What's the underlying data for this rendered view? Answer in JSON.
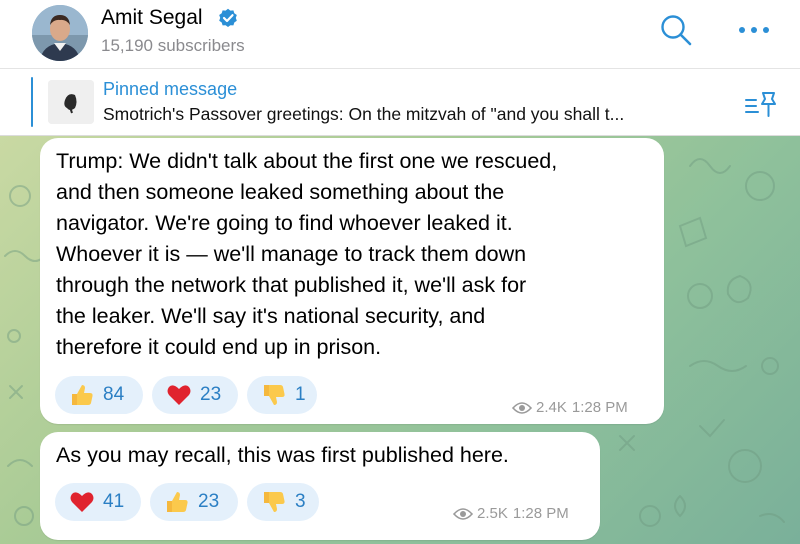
{
  "header": {
    "channel_name": "Amit Segal",
    "subscribers": "15,190 subscribers",
    "icons": {
      "verified": "verified-badge-icon",
      "search": "search-icon",
      "more": "more-dots-icon"
    }
  },
  "pinned": {
    "title": "Pinned message",
    "text": "Smotrich's Passover greetings:  On the mitzvah of \"and you shall t...",
    "icon": "unpin-icon"
  },
  "messages": [
    {
      "lines": [
        "Trump: We didn't talk about the first one we rescued,",
        "and then someone leaked something about the",
        "navigator. We're going to find whoever leaked it.",
        "Whoever it is — we'll manage to track them down",
        "through the network that published it, we'll ask for",
        "the leaker. We'll say it's national security, and",
        "therefore it could end up in prison."
      ],
      "reactions": [
        {
          "emoji": "thumbs-up",
          "count": "84"
        },
        {
          "emoji": "red-heart",
          "count": "23"
        },
        {
          "emoji": "thumbs-down",
          "count": "1"
        }
      ],
      "views": "2.4K",
      "time": "1:28 PM"
    },
    {
      "lines": [
        "As you may recall, this was first published here."
      ],
      "reactions": [
        {
          "emoji": "red-heart",
          "count": "41"
        },
        {
          "emoji": "thumbs-up",
          "count": "23"
        },
        {
          "emoji": "thumbs-down",
          "count": "3"
        }
      ],
      "views": "2.5K",
      "time": "1:28 PM"
    }
  ],
  "colors": {
    "accent": "#2b8fd6",
    "reaction_bg": "#e4f0fb",
    "reaction_text": "#2b7fc4"
  }
}
